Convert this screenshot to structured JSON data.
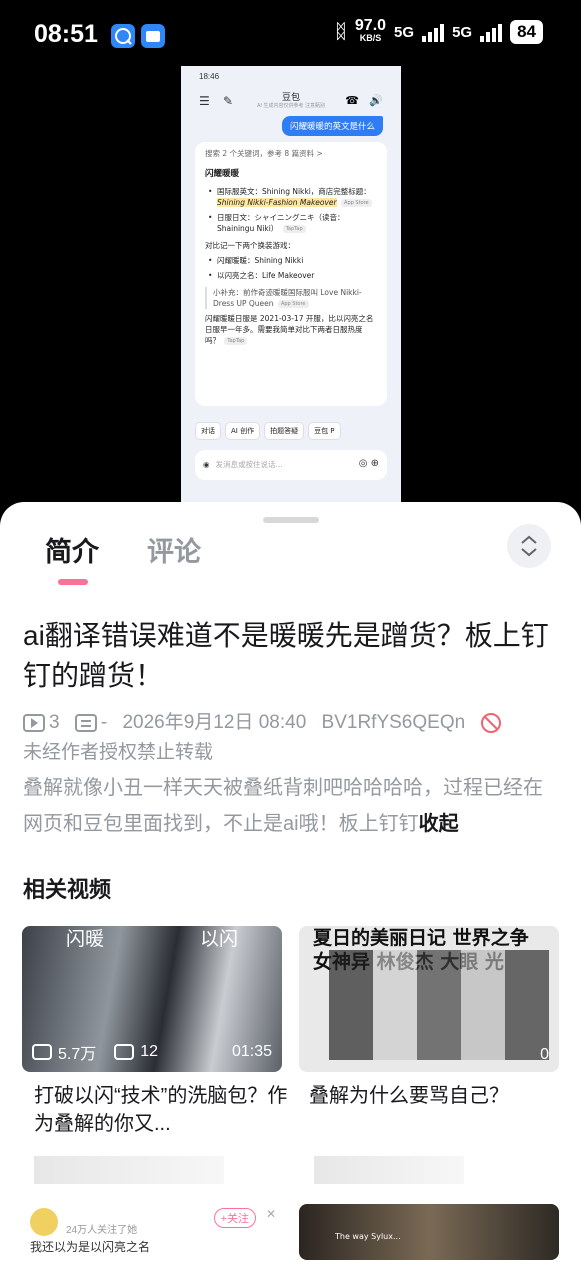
{
  "status_bar": {
    "time": "08:51",
    "net_speed": "97.0",
    "net_unit": "KB/S",
    "sim1": "5G",
    "sim2": "5G",
    "battery": "84",
    "app_icon_colors": [
      "#2f86f6",
      "#2f86f6"
    ]
  },
  "video_frame": {
    "status_time": "18:46",
    "chat_title": "豆包",
    "chat_subtitle": "AI 生成内容仅供参考 注意甄别",
    "user_message": "闪耀暖暖的英文是什么",
    "search_summary": "搜索 2 个关键词，参考 8 篇资料 >",
    "answer_heading": "闪耀暖暖",
    "bullets": [
      {
        "label": "国际服英文：Shining Nikki，商店完整标题：",
        "highlight": "Shining Nikki-Fashion Makeover",
        "tag": "App Store"
      },
      {
        "label": "日服日文：シャイニングニキ（读音：Shainingu Niki）",
        "highlight": "",
        "tag": "TapTap"
      }
    ],
    "compare_text": "对比记一下两个换装游戏：",
    "compare_items": [
      "闪耀暖暖：Shining Nikki",
      "以闪亮之名：Life Makeover"
    ],
    "note": "小补充：前作奇迹暖暖国际服叫 Love Nikki-Dress UP Queen",
    "note_tag": "App Store",
    "tail_text": "闪耀暖暖日服是 2021-03-17 开服，比以闪亮之名日服早一年多。需要我简单对比下两者日服热度吗？",
    "tail_tag": "TapTap",
    "tools": [
      "对话",
      "AI 创作",
      "拍题答疑",
      "豆包 P"
    ],
    "input_placeholder": "发消息或按住说话..."
  },
  "tabs": {
    "intro": "简介",
    "comments": "评论"
  },
  "video": {
    "title": "ai翻译错误难道不是暖暖先是蹭货？板上钉钉的蹭货！",
    "plays": "3",
    "danmaku": "-",
    "date": "2026年9月12日 08:40",
    "bvid": "BV1RfYS6QEQn",
    "copyright": "未经作者授权禁止转载",
    "description": "叠解就像小丑一样天天被叠纸背刺吧哈哈哈哈，过程已经在网页和豆包里面找到，不止是ai哦！板上钉钉",
    "collapse_label": "收起"
  },
  "related": {
    "heading": "相关视频",
    "items": [
      {
        "overlay_left": "闪暖",
        "overlay_right": "以闪",
        "views": "5.7万",
        "danmaku": "12",
        "duration": "01:35",
        "title": "打破以闪“技术”的洗脑包？作为叠解的你又..."
      },
      {
        "overlay_text": "夏日的美丽日记 世界之争 女神异 林俊杰 大眼 光",
        "duration": "0",
        "title": "叠解为什么要骂自己？"
      }
    ],
    "comment_card": {
      "followers": "24万人关注了她",
      "follow_label": "+关注",
      "text": "我还以为是以闪亮之名"
    },
    "fourth_caption": "The way Sylux..."
  }
}
